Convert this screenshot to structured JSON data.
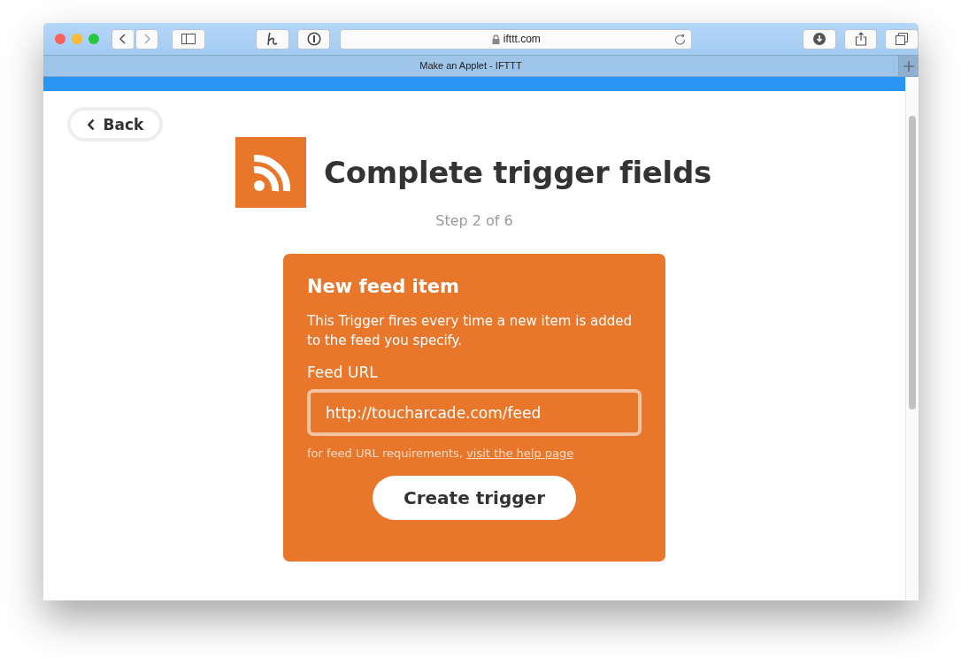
{
  "browser": {
    "address": "ifttt.com",
    "tab_title": "Make an Applet - IFTTT"
  },
  "back_button": {
    "label": "Back"
  },
  "header": {
    "title": "Complete trigger fields",
    "step": "Step 2 of 6"
  },
  "trigger_card": {
    "title": "New feed item",
    "description": "This Trigger fires every time a new item is added to the feed you specify.",
    "field_label": "Feed URL",
    "field_value": "http://toucharcade.com/feed",
    "help_text": "for feed URL requirements,",
    "help_link": "visit the help page",
    "button": "Create trigger"
  }
}
